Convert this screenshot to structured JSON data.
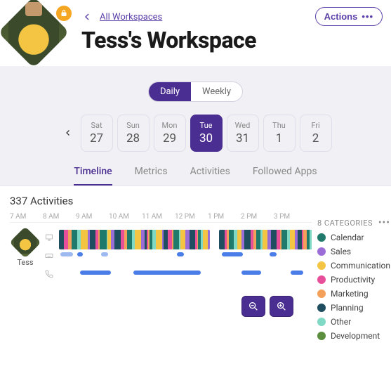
{
  "header": {
    "breadcrumb_label": "All Workspaces",
    "title": "Tess's Workspace",
    "actions_label": "Actions"
  },
  "view_toggle": {
    "daily": "Daily",
    "weekly": "Weekly",
    "active": "daily"
  },
  "days": [
    {
      "dow": "Sat",
      "num": "27"
    },
    {
      "dow": "Sun",
      "num": "28"
    },
    {
      "dow": "Mon",
      "num": "29"
    },
    {
      "dow": "Tue",
      "num": "30",
      "active": true
    },
    {
      "dow": "Wed",
      "num": "31"
    },
    {
      "dow": "Thu",
      "num": "1"
    },
    {
      "dow": "Fri",
      "num": "2"
    }
  ],
  "tabs": {
    "timeline": "Timeline",
    "metrics": "Metrics",
    "activities": "Activities",
    "followed": "Followed Apps",
    "active": "timeline"
  },
  "panel_title": "337 Activities",
  "hours": [
    "7 AM",
    "8 AM",
    "9 AM",
    "10 AM",
    "11 AM",
    "12 PM",
    "1 PM",
    "2 PM",
    "3 PM"
  ],
  "user": {
    "name": "Tess"
  },
  "categories_header": "8 CATEGORIES",
  "categories": [
    {
      "label": "Calendar",
      "color": "#1f7a6b"
    },
    {
      "label": "Sales",
      "color": "#9b6dd7"
    },
    {
      "label": "Communication",
      "color": "#f4c542"
    },
    {
      "label": "Productivity",
      "color": "#e84f9a"
    },
    {
      "label": "Marketing",
      "color": "#f5a05a"
    },
    {
      "label": "Planning",
      "color": "#1e4e5f"
    },
    {
      "label": "Other",
      "color": "#7fd9c4"
    },
    {
      "label": "Development",
      "color": "#5b8f3e"
    }
  ],
  "colors": {
    "primary": "#4b2e91",
    "link": "#5b3fa8",
    "blue_bar": "#4a7de8",
    "blue_light": "#9db9f0"
  }
}
